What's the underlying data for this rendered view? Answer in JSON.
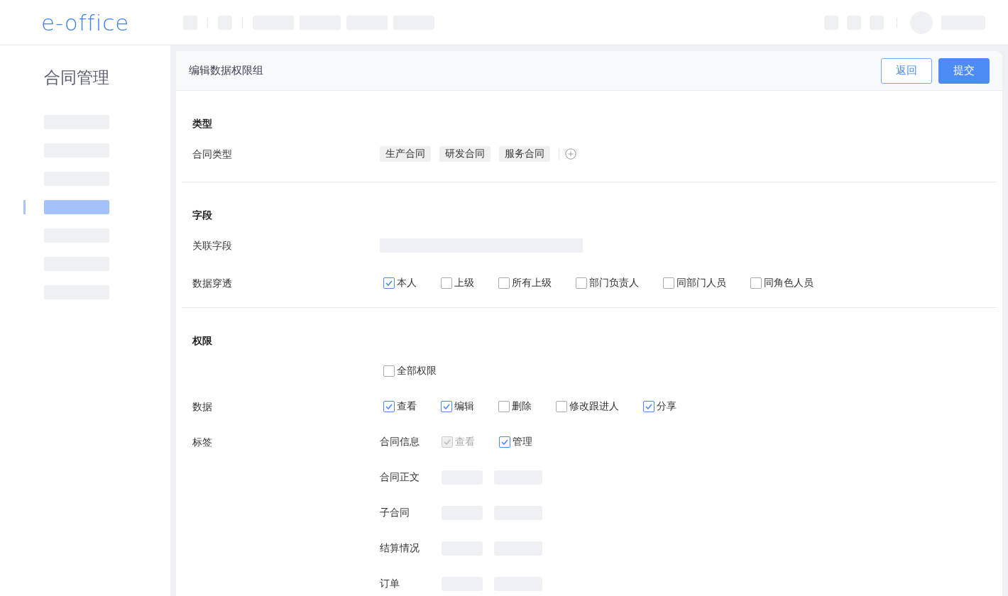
{
  "header": {
    "logo": "e-office"
  },
  "sidebar": {
    "title": "合同管理",
    "items": [
      {
        "selected": false
      },
      {
        "selected": false
      },
      {
        "selected": false
      },
      {
        "selected": true
      },
      {
        "selected": false
      },
      {
        "selected": false
      },
      {
        "selected": false
      }
    ]
  },
  "panel": {
    "title": "编辑数据权限组",
    "buttons": [
      {
        "label": "返回",
        "kind": "secondary"
      },
      {
        "label": "提交",
        "kind": "primary"
      }
    ]
  },
  "sections": [
    {
      "title": "类型",
      "rows": [
        {
          "kind": "tags",
          "label": "合同类型",
          "tags": [
            "生产合同",
            "研发合同",
            "服务合同"
          ]
        }
      ]
    },
    {
      "title": "字段",
      "rows": [
        {
          "kind": "field",
          "label": "关联字段"
        },
        {
          "kind": "checks",
          "label": "数据穿透",
          "options": [
            {
              "label": "本人",
              "checked": true,
              "disabled": false
            },
            {
              "label": "上级",
              "checked": false,
              "disabled": false
            },
            {
              "label": "所有上级",
              "checked": false,
              "disabled": false
            },
            {
              "label": "部门负责人",
              "checked": false,
              "disabled": false
            },
            {
              "label": "同部门人员",
              "checked": false,
              "disabled": false
            },
            {
              "label": "同角色人员",
              "checked": false,
              "disabled": false
            }
          ]
        }
      ]
    },
    {
      "title": "权限",
      "rows": [
        {
          "kind": "checks",
          "options": [
            {
              "label": "全部权限",
              "checked": false,
              "disabled": false
            }
          ]
        },
        {
          "kind": "checks",
          "label": "数据",
          "options": [
            {
              "label": "查看",
              "checked": true,
              "disabled": false
            },
            {
              "label": "编辑",
              "checked": true,
              "disabled": false
            },
            {
              "label": "删除",
              "checked": false,
              "disabled": false
            },
            {
              "label": "修改跟进人",
              "checked": false,
              "disabled": false
            },
            {
              "label": "分享",
              "checked": true,
              "disabled": false
            }
          ]
        },
        {
          "kind": "groups",
          "label": "标签",
          "groups": [
            {
              "name": "合同信息",
              "options": [
                {
                  "label": "查看",
                  "checked": true,
                  "disabled": true
                },
                {
                  "label": "管理",
                  "checked": true,
                  "disabled": false
                }
              ]
            },
            {
              "name": "合同正文"
            },
            {
              "name": "子合同"
            },
            {
              "name": "结算情况"
            },
            {
              "name": "订单"
            }
          ]
        }
      ]
    }
  ]
}
